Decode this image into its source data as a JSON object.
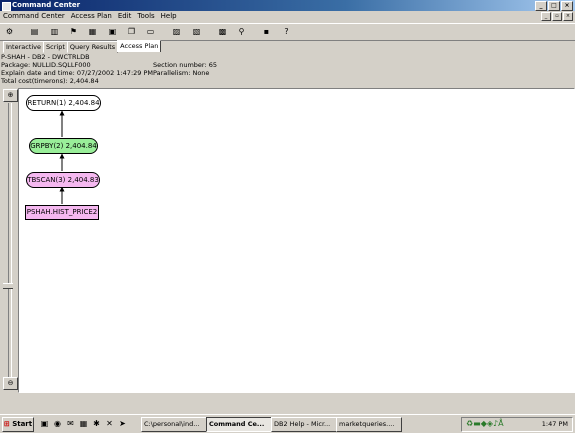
{
  "window": {
    "title": "Command Center"
  },
  "menu": [
    "Command Center",
    "Access Plan",
    "Edit",
    "Tools",
    "Help"
  ],
  "tabs": [
    {
      "label": "Interactive",
      "active": false
    },
    {
      "label": "Script",
      "active": false
    },
    {
      "label": "Query Results",
      "active": false
    },
    {
      "label": "Access Plan",
      "active": true
    }
  ],
  "plan_info": {
    "line1": "P-SHAH - DB2 - DWCTRLDB",
    "package": "Package: NULLID.SQLLF000",
    "explain": "Explain date and time: 07/27/2002 1:47:29 PM",
    "total_cost": "Total cost(timerons): 2,404.84",
    "section": "Section number: 65",
    "parallelism": "Parallelism: None"
  },
  "plan_nodes": [
    {
      "label": "RETURN(1) 2,404.84",
      "fill": "#ffffff",
      "shape": "ellipse"
    },
    {
      "label": "GRPBY(2) 2,404.84",
      "fill": "#99ee99",
      "shape": "ellipse"
    },
    {
      "label": "TBSCAN(3) 2,404.83",
      "fill": "#f5b8f0",
      "shape": "ellipse"
    },
    {
      "label": "PSHAH.HIST_PRICE2",
      "fill": "#f5b8f0",
      "shape": "rect"
    }
  ],
  "taskbar": {
    "start_label": "Start",
    "tasks": [
      {
        "label": "C:\\personal\\ind...",
        "active": false
      },
      {
        "label": "Command Ce...",
        "active": true
      },
      {
        "label": "DB2 Help - Micr...",
        "active": false
      },
      {
        "label": "marketqueries....",
        "active": false
      }
    ],
    "clock": "1:47 PM"
  }
}
